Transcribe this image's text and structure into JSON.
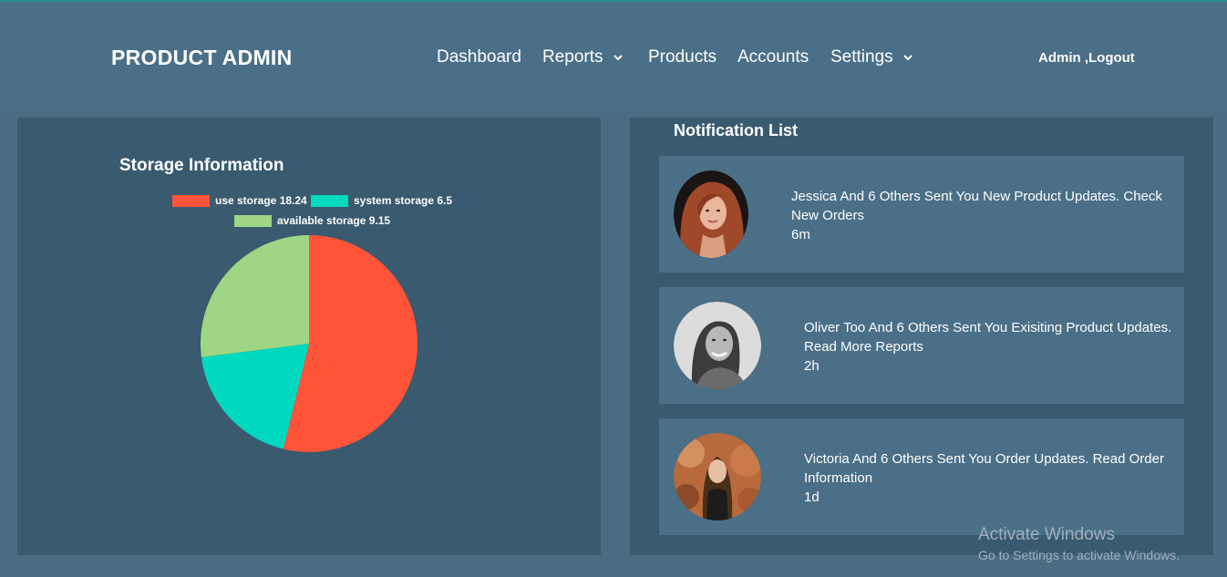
{
  "header": {
    "brand": "PRODUCT ADMIN",
    "nav": [
      {
        "label": "Dashboard",
        "dropdown": false
      },
      {
        "label": "Reports",
        "dropdown": true
      },
      {
        "label": "Products",
        "dropdown": false
      },
      {
        "label": "Accounts",
        "dropdown": false
      },
      {
        "label": "Settings",
        "dropdown": true
      }
    ],
    "admin_label": "Admin ,Logout"
  },
  "storage": {
    "title": "Storage Information",
    "legend": [
      {
        "label": "use storage 18.24",
        "color": "#ff5439"
      },
      {
        "label": "system storage 6.5",
        "color": "#00d9bf"
      },
      {
        "label": "available storage 9.15",
        "color": "#9ed684"
      }
    ]
  },
  "chart_data": {
    "type": "pie",
    "title": "Storage Information",
    "categories": [
      "use storage",
      "system storage",
      "available storage"
    ],
    "values": [
      18.24,
      6.5,
      9.15
    ],
    "colors": [
      "#ff5439",
      "#00d9bf",
      "#9ed684"
    ],
    "legend_position": "top"
  },
  "notifications": {
    "title": "Notification List",
    "items": [
      {
        "message": "Jessica And 6 Others Sent You New Product Updates. Check New Orders",
        "time": "6m",
        "avatar": "woman-red-hair-avatar"
      },
      {
        "message": "Oliver Too And 6 Others Sent You Exisiting Product Updates. Read More Reports",
        "time": "2h",
        "avatar": "woman-grayscale-avatar"
      },
      {
        "message": "Victoria And 6 Others Sent You Order Updates. Read Order Information",
        "time": "1d",
        "avatar": "woman-autumn-avatar"
      }
    ]
  },
  "watermark": {
    "line1": "Activate Windows",
    "line2": "Go to Settings to activate Windows."
  }
}
